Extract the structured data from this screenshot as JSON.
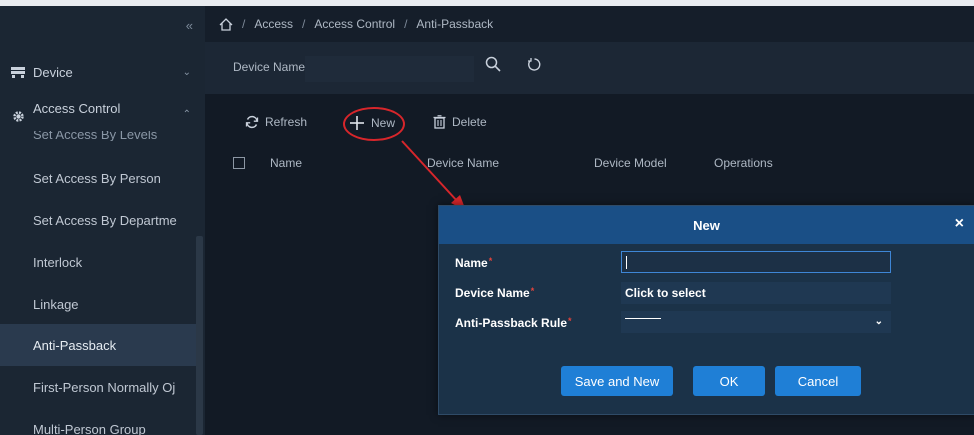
{
  "sidebar": {
    "collapse_icon": "double-chevron-left-icon",
    "groups": [
      {
        "label": "Device",
        "icon": "device-icon",
        "chevron": "chevron-down-icon"
      },
      {
        "label": "Access Control",
        "icon": "gear-icon",
        "chevron": "chevron-up-icon"
      }
    ],
    "partial_item": "Set Access By Levels",
    "items": [
      {
        "label": "Set Access By Person"
      },
      {
        "label": "Set Access By Departme"
      },
      {
        "label": "Interlock"
      },
      {
        "label": "Linkage"
      },
      {
        "label": "Anti-Passback",
        "active": true
      },
      {
        "label": "First-Person Normally Oj"
      },
      {
        "label": "Multi-Person Group"
      }
    ]
  },
  "breadcrumb": {
    "home_icon": "home-icon",
    "separator": "/",
    "crumbs": [
      "Access",
      "Access Control",
      "Anti-Passback"
    ]
  },
  "search": {
    "label": "Device Name",
    "value": "",
    "search_icon": "search-icon",
    "reset_icon": "refresh-icon"
  },
  "toolbar": {
    "refresh_label": "Refresh",
    "new_label": "New",
    "delete_label": "Delete"
  },
  "table": {
    "headers": [
      "Name",
      "Device Name",
      "Device Model",
      "Operations"
    ]
  },
  "dialog": {
    "title": "New",
    "close_label": "×",
    "fields": {
      "name_label": "Name",
      "name_value": "",
      "device_name_label": "Device Name",
      "device_name_placeholder": "Click to select",
      "rule_label": "Anti-Passback Rule",
      "rule_value": "",
      "required_mark": "*"
    },
    "buttons": {
      "save_and_new": "Save and New",
      "ok": "OK",
      "cancel": "Cancel"
    }
  },
  "colors": {
    "highlight_annotation": "#d7262b",
    "dialog_header": "#1a4f86",
    "primary_button": "#1f7fd6",
    "required_mark": "#e6443c"
  }
}
